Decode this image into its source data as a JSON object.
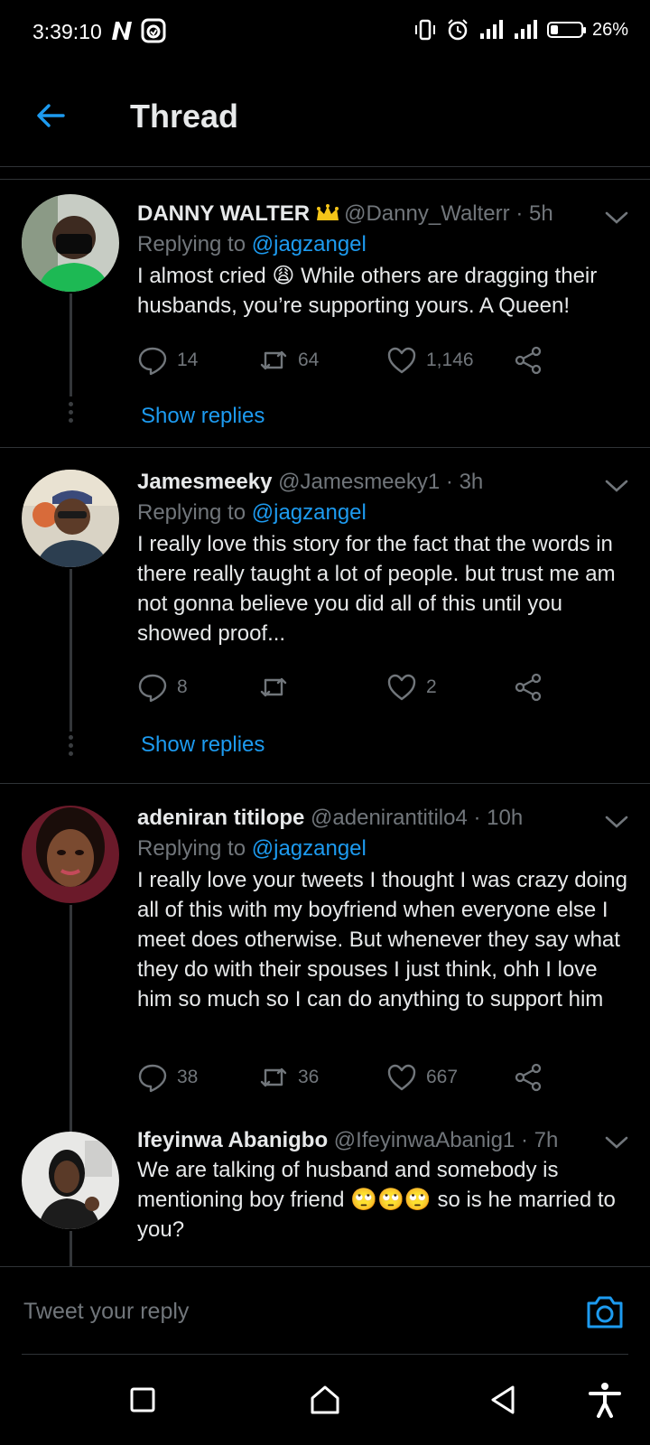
{
  "status_bar": {
    "time": "3:39:10",
    "battery": "26%",
    "battery_level": 0.26,
    "icons": [
      "n-app-icon",
      "inbox-icon",
      "vibrate-icon",
      "alarm-icon",
      "signal-icon",
      "signal-icon",
      "battery-icon"
    ]
  },
  "header": {
    "title": "Thread",
    "back_icon": "arrow-left-icon"
  },
  "colors": {
    "accent": "#1d9bf0",
    "background": "#000000",
    "text": "#e7e9ea",
    "muted": "#71767b",
    "divider": "#2f3336"
  },
  "tweets": [
    {
      "name": "DANNY WALTER",
      "handle": "@Danny_Walterr",
      "time": "· 5h",
      "replying_label": "Replying to",
      "replying_to": "@jagzangel",
      "text": "I almost cried 😩 While others are dragging their husbands, you’re supporting yours. A Queen!",
      "replies": "14",
      "retweets": "64",
      "likes": "1,146",
      "show_replies": "Show replies"
    },
    {
      "name": "Jamesmeeky",
      "handle": "@Jamesmeeky1",
      "time": "· 3h",
      "replying_label": "Replying to",
      "replying_to": "@jagzangel",
      "text": "I really love this story for the fact that the words in there really taught a lot of people. but trust me am not gonna believe you did all of this until you showed proof...",
      "replies": "8",
      "retweets": "",
      "likes": "2",
      "show_replies": "Show replies"
    },
    {
      "name": "adeniran titilope",
      "handle": "@adenirantitilo4",
      "time": "· 10h",
      "replying_label": "Replying to",
      "replying_to": "@jagzangel",
      "text": "I really love your tweets I thought I was crazy doing all of this with my boyfriend when everyone else I meet does otherwise. But whenever they say what they do with their spouses I just think, ohh I love him so much so I can do anything to support him",
      "replies": "38",
      "retweets": "36",
      "likes": "667"
    },
    {
      "name": "Ifeyinwa Abanigbo",
      "handle": "@IfeyinwaAbanig1",
      "time": "· 7h",
      "text": "We are talking of husband and somebody is mentioning boy friend 🙄🙄🙄 so  is he married to you?"
    }
  ],
  "reply_bar": {
    "placeholder": "Tweet your reply",
    "camera_icon": "camera-icon"
  },
  "nav_bar": {
    "icons": [
      "recents-square-icon",
      "home-icon",
      "back-triangle-icon",
      "accessibility-icon"
    ]
  }
}
